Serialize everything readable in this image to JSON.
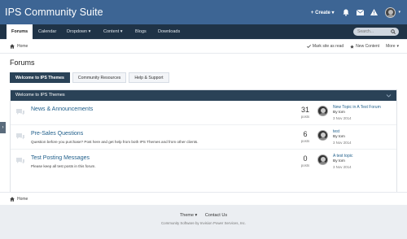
{
  "header": {
    "site_title": "IPS Community Suite",
    "create_label": "Create",
    "icons": [
      "bell-icon",
      "envelope-icon",
      "warning-icon"
    ]
  },
  "nav": {
    "items": [
      {
        "label": "Forums"
      },
      {
        "label": "Calendar"
      },
      {
        "label": "Dropdown ▾"
      },
      {
        "label": "Content ▾"
      },
      {
        "label": "Blogs"
      },
      {
        "label": "Downloads"
      }
    ],
    "search_placeholder": "Search..."
  },
  "breadcrumb": {
    "home": "Home",
    "mark_read": "Mark site as read",
    "new_content": "New Content",
    "more": "More"
  },
  "page": {
    "title": "Forums",
    "tabs": [
      {
        "label": "Welcome to IPS Themes"
      },
      {
        "label": "Community Resources"
      },
      {
        "label": "Help & Support"
      }
    ],
    "category_title": "Welcome to IPS Themes"
  },
  "forums": [
    {
      "name": "News & Announcements",
      "description": "",
      "count": "31",
      "count_label": "posts",
      "last_title": "New Topic in A Test Forum",
      "last_by": "By tom",
      "last_date": "3 Nov 2014"
    },
    {
      "name": "Pre-Sales Questions",
      "description": "Question before you purchase? Post here and get help from both IPS Themes and from other clients.",
      "count": "6",
      "count_label": "posts",
      "last_title": "test",
      "last_by": "By tom",
      "last_date": "3 Nov 2014"
    },
    {
      "name": "Test Posting Messages",
      "description": "Please keep all test posts in this forum.",
      "count": "0",
      "count_label": "posts",
      "last_title": "A test topic",
      "last_by": "By tom",
      "last_date": "3 Nov 2014"
    }
  ],
  "footer": {
    "home": "Home",
    "theme": "Theme ▾",
    "contact": "Contact Us",
    "copyright": "Community Software by Invision Power Services, Inc."
  },
  "colors": {
    "header": "#3d6594",
    "navbar": "#1f3347",
    "accent_dark": "#2a4257",
    "link": "#1f5e8a"
  }
}
